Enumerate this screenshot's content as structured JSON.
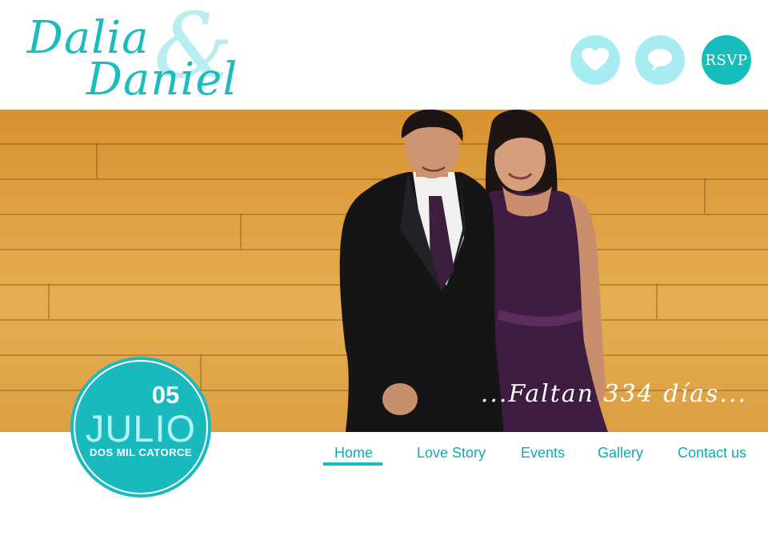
{
  "header": {
    "logo": {
      "name1": "Dalia",
      "ampersand": "&",
      "name2": "Daniel"
    },
    "buttons": [
      {
        "icon": "heart-icon"
      },
      {
        "icon": "speech-bubble-icon"
      },
      {
        "label": "RSVP"
      }
    ]
  },
  "hero": {
    "countdown": "...Faltan 334 días..."
  },
  "badge": {
    "day": "05",
    "month": "JULIO",
    "year_text": "DOS MIL CATORCE"
  },
  "nav": {
    "items": [
      {
        "label": "Home",
        "active": true
      },
      {
        "label": "Love Story"
      },
      {
        "label": "Events"
      },
      {
        "label": "Gallery"
      },
      {
        "label": "Contact us"
      }
    ]
  },
  "colors": {
    "accent": "#16bdbd",
    "accent_light": "#a6ecf1",
    "wood": "#e1a548"
  }
}
